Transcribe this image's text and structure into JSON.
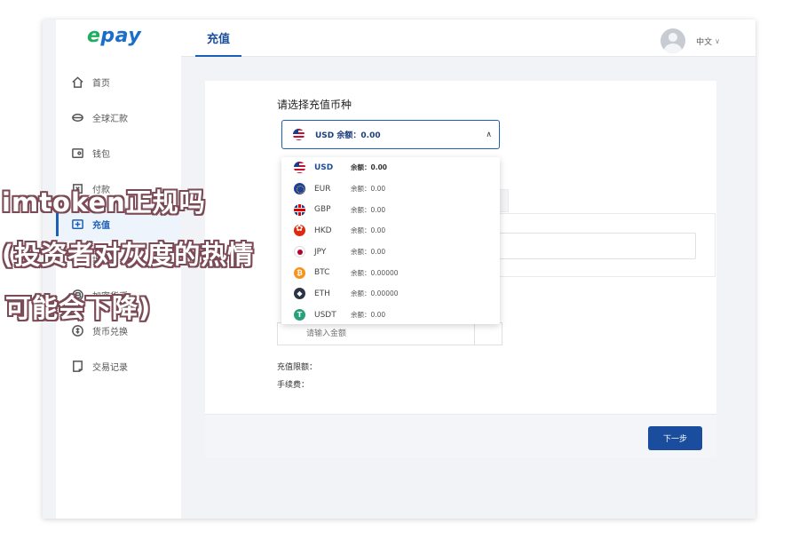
{
  "logo": {
    "e": "e",
    "rest": "pay"
  },
  "sidebar": {
    "items": [
      {
        "label": "首页",
        "icon": "home-icon",
        "active": false
      },
      {
        "label": "全球汇款",
        "icon": "globe-icon",
        "active": false
      },
      {
        "label": "钱包",
        "icon": "wallet-icon",
        "active": false
      },
      {
        "label": "付款",
        "icon": "payment-icon",
        "active": false
      },
      {
        "label": "充值",
        "icon": "recharge-icon",
        "active": true
      },
      {
        "label": "提现",
        "icon": "withdraw-icon",
        "active": false
      },
      {
        "label": "加密货币",
        "icon": "crypto-icon",
        "active": false
      },
      {
        "label": "货币兑换",
        "icon": "exchange-icon",
        "active": false
      },
      {
        "label": "交易记录",
        "icon": "records-icon",
        "active": false
      }
    ]
  },
  "header": {
    "tab": "充值",
    "language": "中文"
  },
  "form": {
    "currency_title": "请选择充值币种",
    "selected_value": "USD 余额：0.00",
    "amount_placeholder": "请输入金额",
    "limit_label": "充值限额：",
    "fee_label": "手续费：",
    "next_button": "下一步"
  },
  "dropdown": {
    "options": [
      {
        "code": "USD",
        "balance": "余额：0.00",
        "icon": "usd-flag-icon",
        "selected": true
      },
      {
        "code": "EUR",
        "balance": "余额：0.00",
        "icon": "eur-flag-icon",
        "selected": false
      },
      {
        "code": "GBP",
        "balance": "余额：0.00",
        "icon": "gbp-flag-icon",
        "selected": false
      },
      {
        "code": "HKD",
        "balance": "余额：0.00",
        "icon": "hkd-flag-icon",
        "selected": false
      },
      {
        "code": "JPY",
        "balance": "余额：0.00",
        "icon": "jpy-flag-icon",
        "selected": false
      },
      {
        "code": "BTC",
        "balance": "余额：0.00000",
        "icon": "btc-coin-icon",
        "selected": false
      },
      {
        "code": "ETH",
        "balance": "余额：0.00000",
        "icon": "eth-coin-icon",
        "selected": false
      },
      {
        "code": "USDT",
        "balance": "余额：0.00",
        "icon": "usdt-coin-icon",
        "selected": false
      }
    ]
  },
  "watermark": {
    "line1": "imtoken正规吗",
    "line2": "(投资者对灰度的热情",
    "line3": "可能会下降)"
  },
  "colors": {
    "primary": "#1b4d9e",
    "logo_green": "#1fae5f",
    "logo_blue": "#1b6fc8",
    "watermark_outline": "#7b4a55"
  }
}
